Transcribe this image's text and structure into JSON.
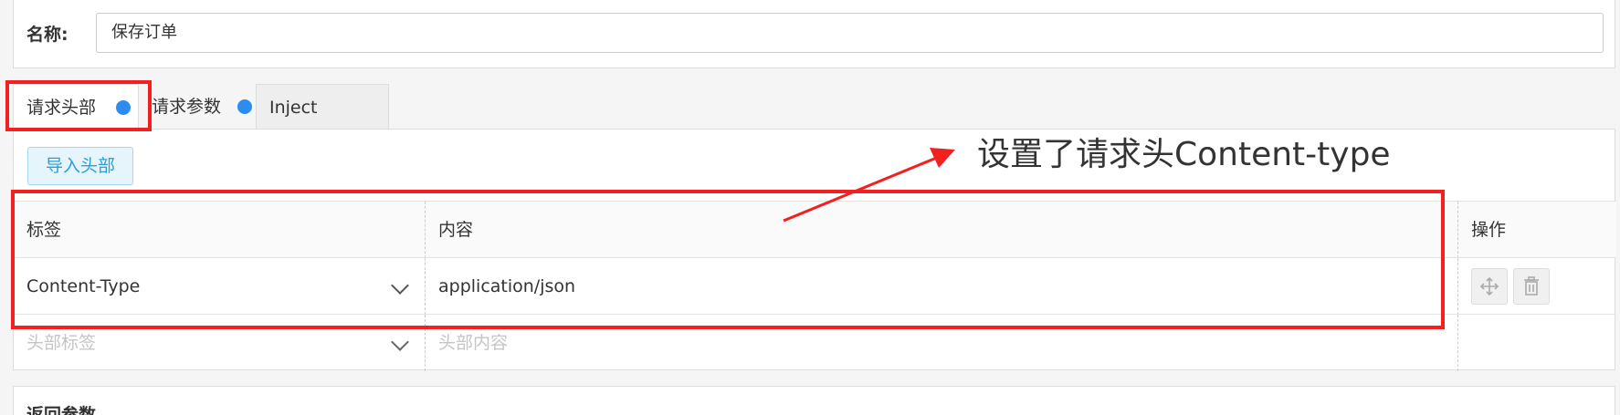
{
  "name_field": {
    "label": "名称:",
    "value": "保存订单"
  },
  "tabs": [
    {
      "label": "请求头部",
      "has_dot": true
    },
    {
      "label": "请求参数",
      "has_dot": true
    },
    {
      "label": "Inject",
      "has_dot": false
    }
  ],
  "import_button": {
    "label": "导入头部"
  },
  "table": {
    "columns": [
      "标签",
      "内容",
      "操作"
    ],
    "rows": [
      {
        "tag": "Content-Type",
        "content": "application/json"
      }
    ],
    "new_row": {
      "tag_placeholder": "头部标签",
      "content_placeholder": "头部内容"
    },
    "actions": [
      "move-icon",
      "trash-icon"
    ]
  },
  "bottom_section": {
    "title": "返回参数"
  },
  "annotation": {
    "text": "设置了请求头Content-type"
  },
  "colors": {
    "accent": "#2d8cf0",
    "highlight": "#f2211f",
    "import_text": "#2aa0d8"
  }
}
